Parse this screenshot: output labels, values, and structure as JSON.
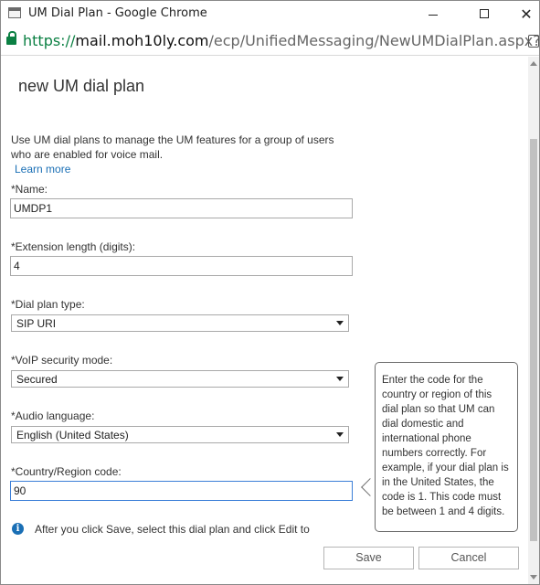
{
  "window": {
    "title": "UM Dial Plan - Google Chrome",
    "min_glyph": "",
    "close_glyph": "✕"
  },
  "address": {
    "scheme": "https://",
    "host": "mail.moh10ly.com",
    "path": "/ecp/UnifiedMessaging/NewUMDialPlan.aspx?pwmc"
  },
  "page": {
    "title": "new UM dial plan",
    "intro": "Use UM dial plans to manage the UM features for a group of users who are enabled for voice mail.",
    "learn_more": "Learn more"
  },
  "form": {
    "name": {
      "label": "*Name:",
      "value": "UMDP1"
    },
    "extension_length": {
      "label": "*Extension length (digits):",
      "value": "4"
    },
    "dial_plan_type": {
      "label": "*Dial plan type:",
      "value": "SIP URI"
    },
    "voip_security_mode": {
      "label": "*VoIP security mode:",
      "value": "Secured"
    },
    "audio_language": {
      "label": "*Audio language:",
      "value": "English (United States)"
    },
    "country_region_code": {
      "label": "*Country/Region code:",
      "value": "90"
    }
  },
  "tooltip": {
    "text": "Enter the code for the country or region of this dial plan so that UM can dial domestic and international phone numbers correctly. For example, if your dial plan is in the United States, the code is 1. This code must be between 1 and 4 digits."
  },
  "info": {
    "icon": "info-icon",
    "text": "After you click Save, select this dial plan and click Edit to"
  },
  "buttons": {
    "save": "Save",
    "cancel": "Cancel"
  },
  "colors": {
    "link": "#1a6fb5",
    "secure_green": "#0b8043",
    "focus_border": "#3b7fd8"
  }
}
